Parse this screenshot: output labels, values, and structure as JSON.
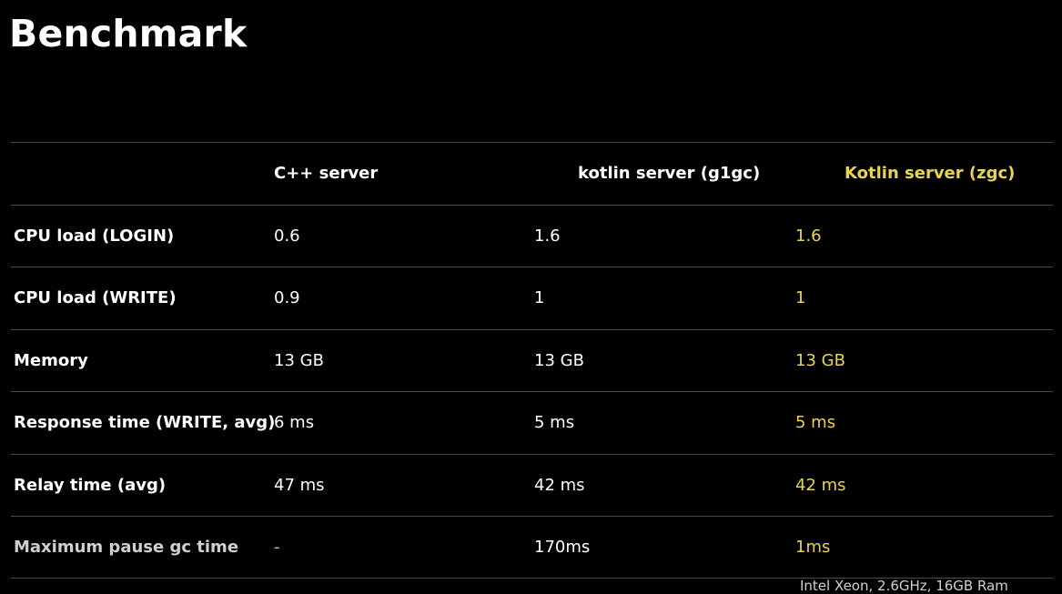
{
  "title": "Benchmark",
  "colors": {
    "background": "#000000",
    "text": "#ffffff",
    "accent": "#e8d44d",
    "divider": "#4a4a4a"
  },
  "table": {
    "headers": [
      "",
      "C++ server",
      "kotlin server (g1gc)",
      "Kotlin server (zgc)"
    ],
    "rows": [
      {
        "metric": "CPU load (LOGIN)",
        "cpp": "0.6",
        "g1gc": "1.6",
        "zgc": "1.6"
      },
      {
        "metric": "CPU load (WRITE)",
        "cpp": "0.9",
        "g1gc": "1",
        "zgc": "1"
      },
      {
        "metric": "Memory",
        "cpp": "13 GB",
        "g1gc": "13 GB",
        "zgc": "13 GB"
      },
      {
        "metric": "Response time (WRITE, avg)",
        "cpp": "6 ms",
        "g1gc": "5 ms",
        "zgc": "5 ms"
      },
      {
        "metric": "Relay time (avg)",
        "cpp": "47 ms",
        "g1gc": "42 ms",
        "zgc": "42 ms"
      },
      {
        "metric": "Maximum pause gc time",
        "cpp": "-",
        "g1gc": "170ms",
        "zgc": "1ms"
      }
    ]
  },
  "footnote": "Intel Xeon, 2.6GHz, 16GB Ram"
}
